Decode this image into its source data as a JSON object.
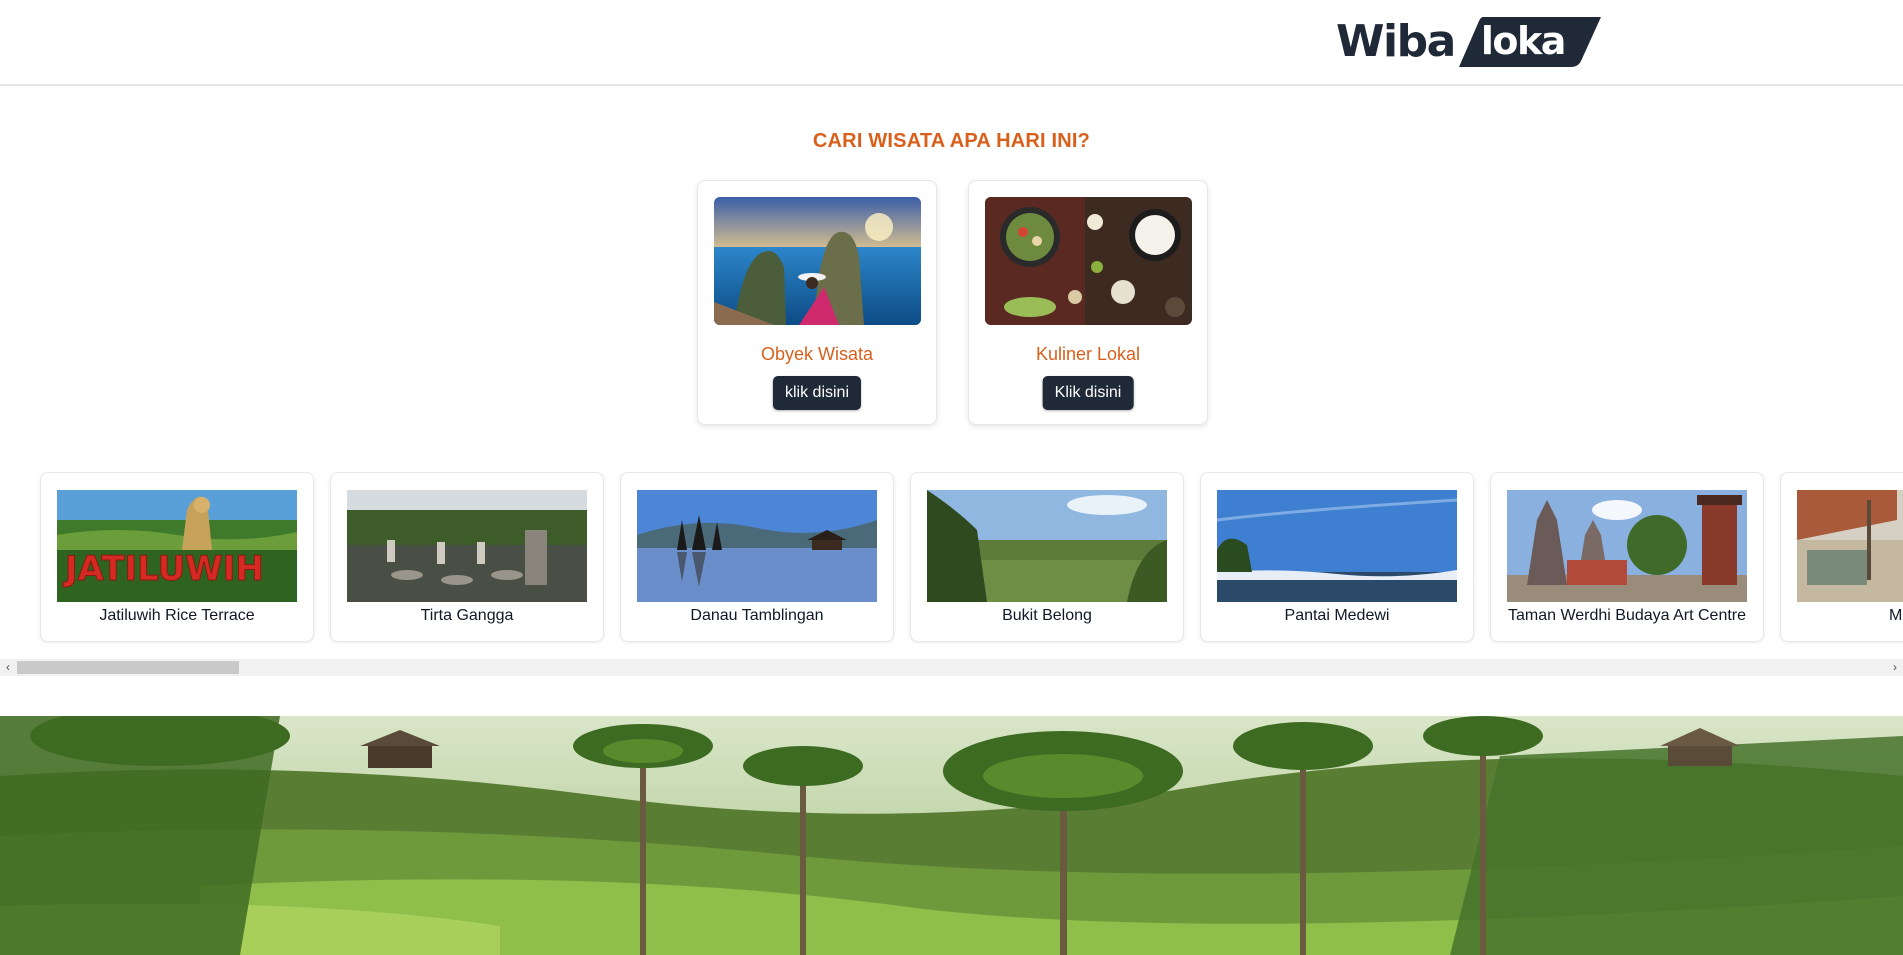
{
  "header": {
    "logo_part1": "Wiba",
    "logo_part2": "loka"
  },
  "section_title": "CARI WISATA APA HARI INI?",
  "categories": [
    {
      "title": "Obyek Wisata",
      "button": "klik disini",
      "image_icon": "tourist-attraction-photo"
    },
    {
      "title": "Kuliner Lokal",
      "button": "Klik disini",
      "image_icon": "local-food-photo"
    }
  ],
  "places": [
    {
      "name": "Jatiluwih Rice Terrace",
      "image_text": "JATILUWIH"
    },
    {
      "name": "Tirta Gangga"
    },
    {
      "name": "Danau Tamblingan"
    },
    {
      "name": "Bukit Belong"
    },
    {
      "name": "Pantai Medewi"
    },
    {
      "name": "Taman Werdhi Budaya Art Centre"
    },
    {
      "name": "Monkey"
    }
  ],
  "scrollbar": {
    "left_arrow": "‹",
    "right_arrow": "›"
  },
  "colors": {
    "accent": "#d9601c",
    "button": "#1f2937",
    "logo_dark": "#1f2937"
  }
}
